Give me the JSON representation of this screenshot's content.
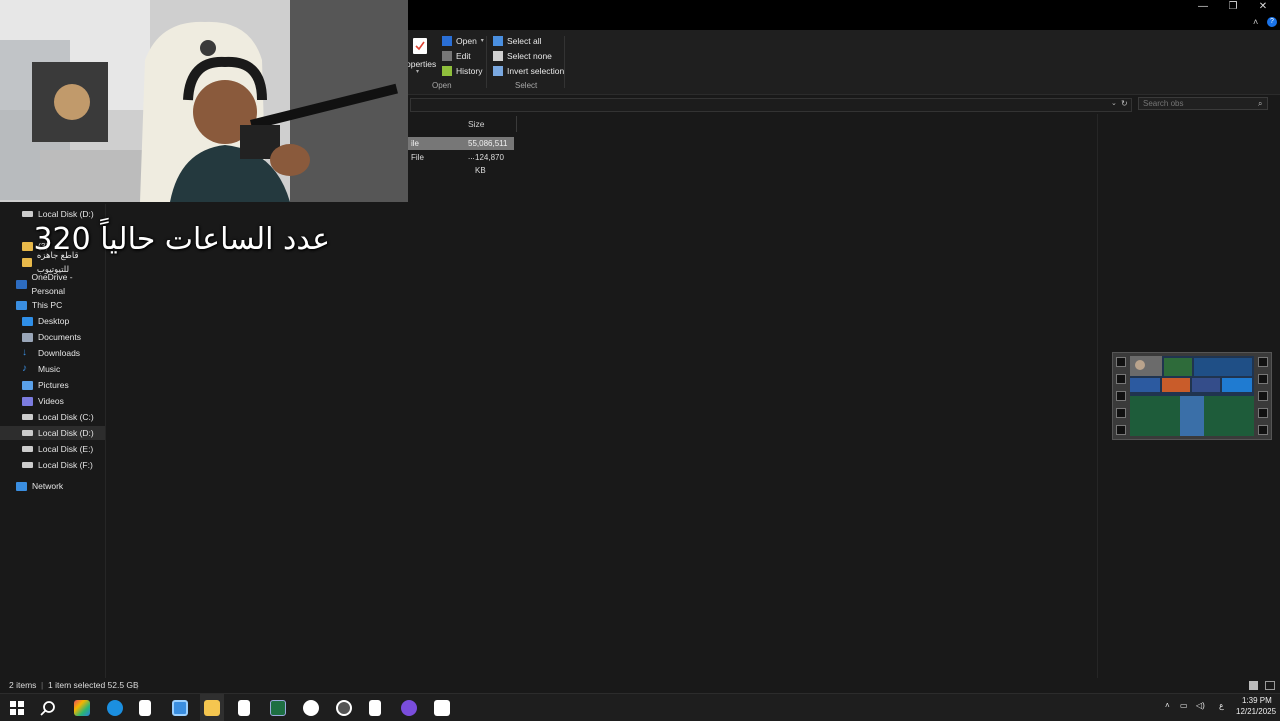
{
  "ribbon": {
    "properties_partial": "operties",
    "open_group": {
      "open": "Open",
      "edit": "Edit",
      "history": "History",
      "label": "Open"
    },
    "select_group": {
      "select_all": "Select all",
      "select_none": "Select none",
      "invert": "Invert selection",
      "label": "Select"
    }
  },
  "search": {
    "placeholder": "Search obs"
  },
  "nav": {
    "items_top": [
      {
        "label": "Local Disk (D:)"
      },
      {
        "label": "(3) "
      },
      {
        "label": "قاطع جاهزه للتيوتيوب"
      }
    ],
    "onedrive": "OneDrive - Personal",
    "this_pc": "This PC",
    "pc_items": [
      "Desktop",
      "Documents",
      "Downloads",
      "Music",
      "Pictures",
      "Videos",
      "Local Disk (C:)",
      "Local Disk (D:)",
      "Local Disk (E:)",
      "Local Disk (F:)"
    ],
    "network": "Network"
  },
  "file_list": {
    "col_size": "Size",
    "rows": [
      {
        "type_partial": "ile",
        "size": "55,086,511 ..."
      },
      {
        "type_partial": "File",
        "size": "124,870 KB"
      }
    ]
  },
  "overlay": {
    "text": "عدد الساعات حالياً 320"
  },
  "status": {
    "items": "2 items",
    "selected": "1 item selected  52.5 GB"
  },
  "taskbar": {
    "time": "1:39 PM",
    "date": "12/21/2025",
    "lang": "ع"
  },
  "colors": {
    "accent": "#0078d4",
    "selected_row": "#777777"
  }
}
